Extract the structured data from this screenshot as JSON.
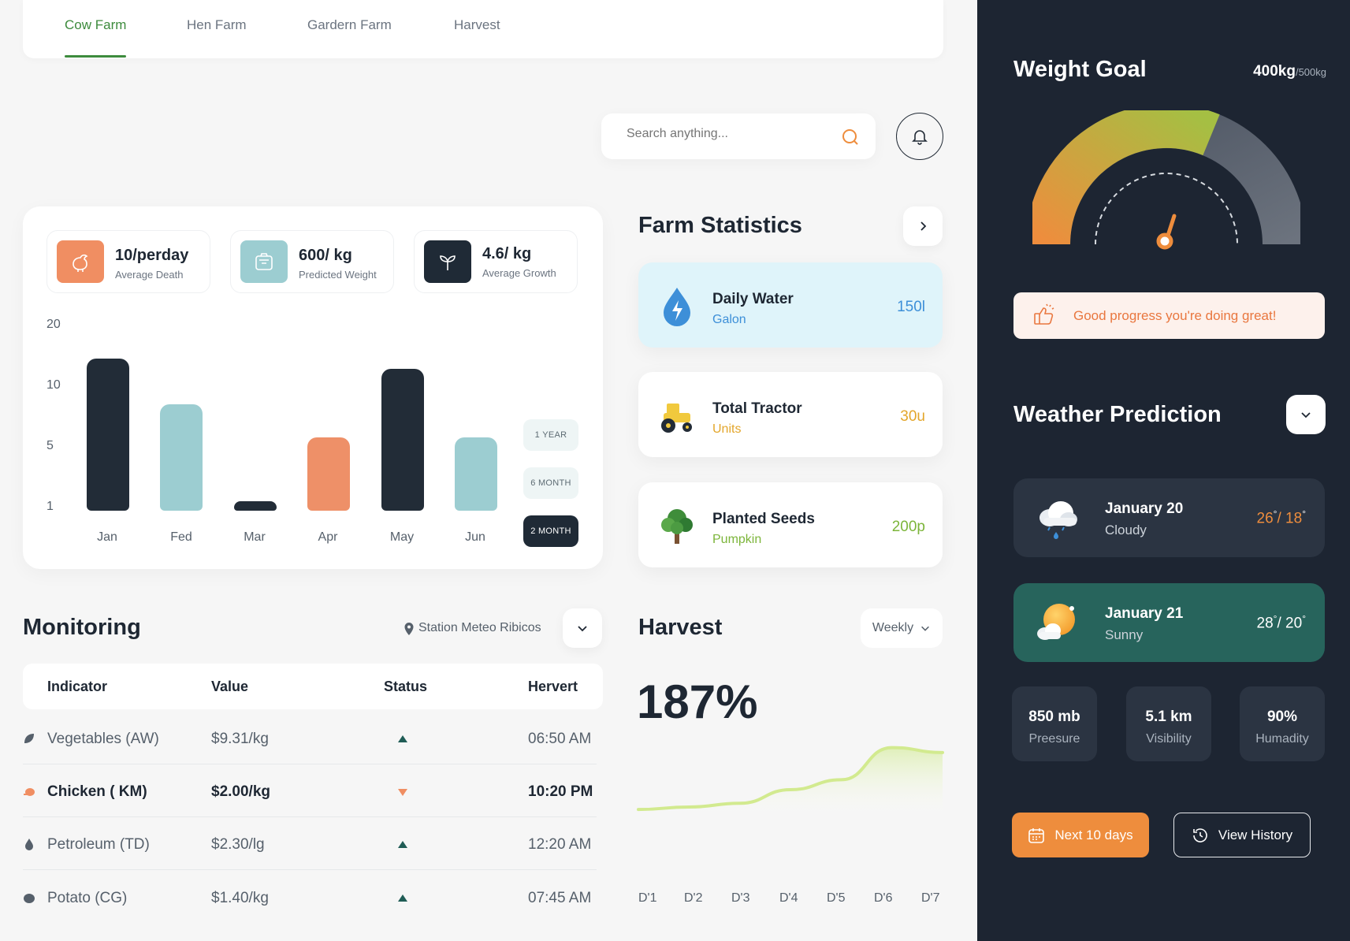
{
  "nav": {
    "tabs": [
      "Cow Farm",
      "Hen Farm",
      "Gardern Farm",
      "Harvest"
    ],
    "active": 0
  },
  "search": {
    "placeholder": "Search anything..."
  },
  "stats": [
    {
      "value": "10/perday",
      "label": "Average Death",
      "color": "#f08e62",
      "icon": "chicken-icon"
    },
    {
      "value": "600/ kg",
      "label": "Predicted Weight",
      "color": "#9ccdd1",
      "icon": "scale-icon"
    },
    {
      "value": "4.6/ kg",
      "label": "Average Growth",
      "color": "#1f2a36",
      "icon": "sprout-icon"
    }
  ],
  "chart_data": {
    "type": "bar",
    "categories": [
      "Jan",
      "Fed",
      "Mar",
      "Apr",
      "May",
      "Jun"
    ],
    "values": [
      14.5,
      8.5,
      1.4,
      5.8,
      12.8,
      5.8
    ],
    "colors": [
      "#222c37",
      "#9ccdd1",
      "#222c37",
      "#ee9068",
      "#222c37",
      "#9ccdd1"
    ],
    "yticks": [
      "20",
      "10",
      "5",
      "1"
    ],
    "title": "",
    "xlabel": "",
    "ylabel": ""
  },
  "ranges": [
    "1 YEAR",
    "6 MONTH",
    "2 MONTH"
  ],
  "farm_stats": {
    "title": "Farm Statistics",
    "items": [
      {
        "title": "Daily Water",
        "sub": "Galon",
        "value": "150l",
        "accent": "#3d8fd8",
        "bg": "#dff4fa",
        "icon": "water-drop-icon"
      },
      {
        "title": "Total Tractor",
        "sub": "Units",
        "value": "30u",
        "accent": "#e3a62b",
        "bg": "#ffffff",
        "icon": "tractor-icon"
      },
      {
        "title": "Planted Seeds",
        "sub": "Pumpkin",
        "value": "200p",
        "accent": "#7cb53a",
        "bg": "#ffffff",
        "icon": "tree-icon"
      }
    ]
  },
  "monitoring": {
    "title": "Monitoring",
    "station": "Station Meteo Ribicos",
    "headers": [
      "Indicator",
      "Value",
      "Status",
      "Hervert"
    ],
    "rows": [
      {
        "indicator": "Vegetables (AW)",
        "value": "$9.31/kg",
        "status": "up",
        "time": "06:50 AM"
      },
      {
        "indicator": "Chicken ( KM)",
        "value": "$2.00/kg",
        "status": "down",
        "time": "10:20 PM"
      },
      {
        "indicator": "Petroleum (TD)",
        "value": "$2.30/lg",
        "status": "up",
        "time": "12:20 AM"
      },
      {
        "indicator": "Potato (CG)",
        "value": "$1.40/kg",
        "status": "up",
        "time": "07:45 AM"
      }
    ]
  },
  "harvest": {
    "title": "Harvest",
    "period": "Weekly",
    "percent": "187%",
    "days": [
      "D'1",
      "D'2",
      "D'3",
      "D'4",
      "D'5",
      "D'6",
      "D'7"
    ],
    "values": [
      12,
      14,
      17,
      28,
      36,
      62,
      58
    ]
  },
  "weight_goal": {
    "title": "Weight Goal",
    "current": "400kg",
    "target": "/500kg",
    "progress": 0.8,
    "message": "Good progress you're doing great!"
  },
  "weather": {
    "title": "Weather Prediction",
    "days": [
      {
        "date": "January 20",
        "cond": "Cloudy",
        "hi": "26",
        "lo": "18",
        "deg": "°"
      },
      {
        "date": "January 21",
        "cond": "Sunny",
        "hi": "28",
        "lo": "20",
        "deg": "°"
      }
    ],
    "metrics": [
      {
        "value": "850 mb",
        "label": "Preesure"
      },
      {
        "value": "5.1 km",
        "label": "Visibility"
      },
      {
        "value": "90%",
        "label": "Humadity"
      }
    ],
    "next_btn": "Next 10 days",
    "history_btn": "View History"
  }
}
